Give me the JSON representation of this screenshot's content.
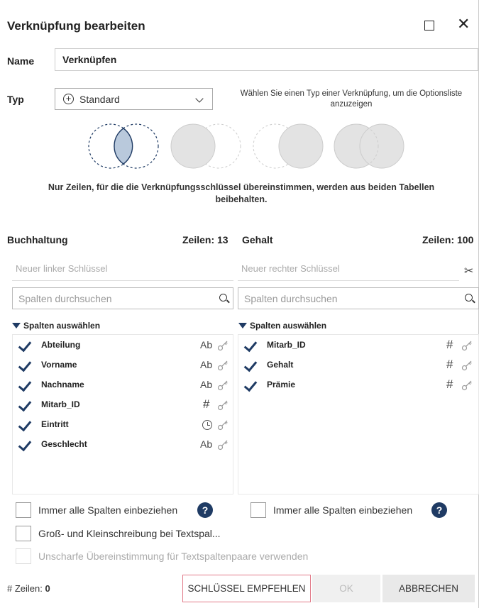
{
  "dialog": {
    "title": "Verknüpfung bearbeiten",
    "maximize_icon": "maximize-icon",
    "close_icon": "close-icon",
    "close_glyph": "✕"
  },
  "name": {
    "label": "Name",
    "value": "Verknüpfen"
  },
  "typ": {
    "label": "Typ",
    "selected": "Standard",
    "plus_glyph": "+",
    "hint": "Wählen Sie einen Typ einer Verknüpfung, um die Optionsliste anzuzeigen",
    "join_types": [
      "inner",
      "left",
      "right",
      "full"
    ],
    "selected_join": "inner",
    "description": "Nur Zeilen, für die die Verknüpfungsschlüssel übereinstimmen, werden aus beiden Tabellen beibehalten."
  },
  "left": {
    "table": "Buchhaltung",
    "rows": "Zeilen: 13",
    "key_placeholder": "Neuer linker Schlüssel",
    "search_placeholder": "Spalten durchsuchen",
    "cols_header": "Spalten auswählen",
    "columns": [
      {
        "name": "Abteilung",
        "type": "Ab",
        "type_icon": "text-type-icon"
      },
      {
        "name": "Vorname",
        "type": "Ab",
        "type_icon": "text-type-icon"
      },
      {
        "name": "Nachname",
        "type": "Ab",
        "type_icon": "text-type-icon"
      },
      {
        "name": "Mitarb_ID",
        "type": "#",
        "type_icon": "number-type-icon"
      },
      {
        "name": "Eintritt",
        "type": "",
        "type_icon": "clock-icon"
      },
      {
        "name": "Geschlecht",
        "type": "Ab",
        "type_icon": "text-type-icon"
      }
    ],
    "always_include": "Immer alle Spalten einbeziehen"
  },
  "right": {
    "table": "Gehalt",
    "rows": "Zeilen: 100",
    "key_placeholder": "Neuer rechter Schlüssel",
    "search_placeholder": "Spalten durchsuchen",
    "cols_header": "Spalten auswählen",
    "columns": [
      {
        "name": "Mitarb_ID",
        "type": "#",
        "type_icon": "number-type-icon"
      },
      {
        "name": "Gehalt",
        "type": "#",
        "type_icon": "number-type-icon"
      },
      {
        "name": "Prämie",
        "type": "#",
        "type_icon": "number-type-icon"
      }
    ],
    "always_include": "Immer alle Spalten einbeziehen"
  },
  "options": {
    "case_sensitivity": "Groß- und Kleinschreibung bei Textspal...",
    "fuzzy_match": "Unscharfe Übereinstimmung für Textspaltenpaare verwenden",
    "help_glyph": "?"
  },
  "footer": {
    "rows_label": "# Zeilen:",
    "rows_value": "0",
    "suggest_keys": "SCHLÜSSEL EMPFEHLEN",
    "ok": "OK",
    "cancel": "ABBRECHEN"
  },
  "colors": {
    "accent": "#1f3b64",
    "suggest_border": "#e27b8a",
    "venn_selected": "#b9c9dc"
  }
}
